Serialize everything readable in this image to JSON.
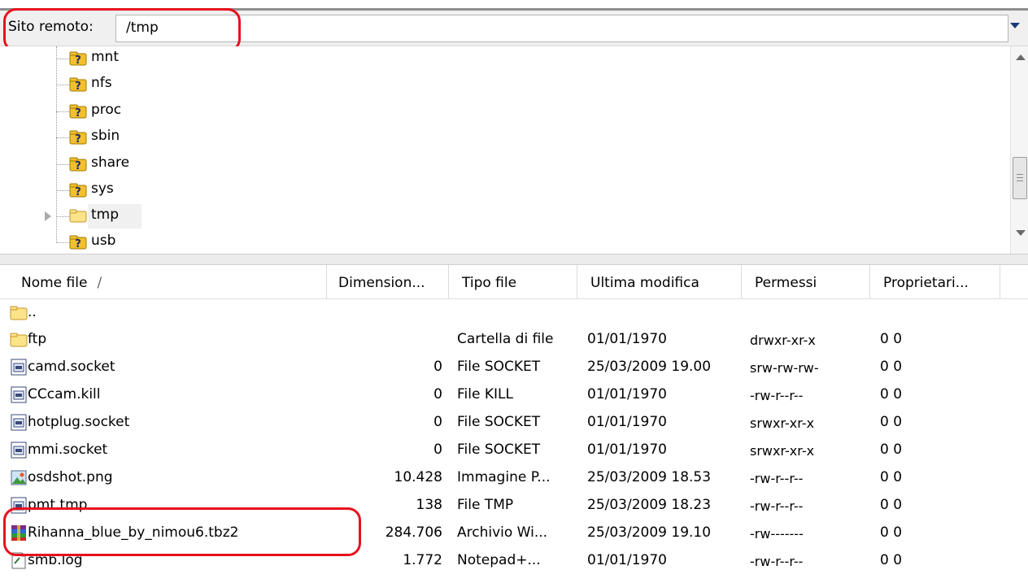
{
  "address_bar": {
    "label": "Sito remoto:",
    "path": "/tmp"
  },
  "tree": {
    "items": [
      {
        "label": "mnt",
        "icon": "unknown-folder-icon"
      },
      {
        "label": "nfs",
        "icon": "unknown-folder-icon"
      },
      {
        "label": "proc",
        "icon": "unknown-folder-icon"
      },
      {
        "label": "sbin",
        "icon": "unknown-folder-icon"
      },
      {
        "label": "share",
        "icon": "unknown-folder-icon"
      },
      {
        "label": "sys",
        "icon": "unknown-folder-icon"
      },
      {
        "label": "tmp",
        "icon": "folder-icon",
        "selected": true,
        "expandable": true
      },
      {
        "label": "usb",
        "icon": "unknown-folder-icon"
      }
    ]
  },
  "columns": {
    "name": "Nome file",
    "sort_indicator": "/",
    "size": "Dimension...",
    "type": "Tipo file",
    "modified": "Ultima modifica",
    "permissions": "Permessi",
    "owner": "Proprietari..."
  },
  "files": [
    {
      "name": "..",
      "size": "",
      "type": "",
      "modified": "",
      "permissions": "",
      "owner": "",
      "icon": "parent-folder-icon"
    },
    {
      "name": "ftp",
      "size": "",
      "type": "Cartella di file",
      "modified": "01/01/1970",
      "permissions": "drwxr-xr-x",
      "owner": "0 0",
      "icon": "folder-icon"
    },
    {
      "name": "camd.socket",
      "size": "0",
      "type": "File SOCKET",
      "modified": "25/03/2009 19.00",
      "permissions": "srw-rw-rw-",
      "owner": "0 0",
      "icon": "file-icon"
    },
    {
      "name": "CCcam.kill",
      "size": "0",
      "type": "File KILL",
      "modified": "01/01/1970",
      "permissions": "-rw-r--r--",
      "owner": "0 0",
      "icon": "file-icon"
    },
    {
      "name": "hotplug.socket",
      "size": "0",
      "type": "File SOCKET",
      "modified": "01/01/1970",
      "permissions": "srwxr-xr-x",
      "owner": "0 0",
      "icon": "file-icon"
    },
    {
      "name": "mmi.socket",
      "size": "0",
      "type": "File SOCKET",
      "modified": "01/01/1970",
      "permissions": "srwxr-xr-x",
      "owner": "0 0",
      "icon": "file-icon"
    },
    {
      "name": "osdshot.png",
      "size": "10.428",
      "type": "Immagine P...",
      "modified": "25/03/2009 18.53",
      "permissions": "-rw-r--r--",
      "owner": "0 0",
      "icon": "image-file-icon"
    },
    {
      "name": "pmt.tmp",
      "size": "138",
      "type": "File TMP",
      "modified": "25/03/2009 18.23",
      "permissions": "-rw-r--r--",
      "owner": "0 0",
      "icon": "file-icon"
    },
    {
      "name": "Rihanna_blue_by_nimou6.tbz2",
      "size": "284.706",
      "type": "Archivio Wi...",
      "modified": "25/03/2009 19.10",
      "permissions": "-rw-------",
      "owner": "0 0",
      "icon": "archive-file-icon"
    },
    {
      "name": "smb.log",
      "size": "1.772",
      "type": "Notepad+...",
      "modified": "01/01/1970",
      "permissions": "-rw-r--r--",
      "owner": "0 0",
      "icon": "text-file-icon"
    }
  ],
  "colors": {
    "highlight": "#e8101e",
    "folder": "#f5c542",
    "unknown_badge": "#f2c02e"
  }
}
